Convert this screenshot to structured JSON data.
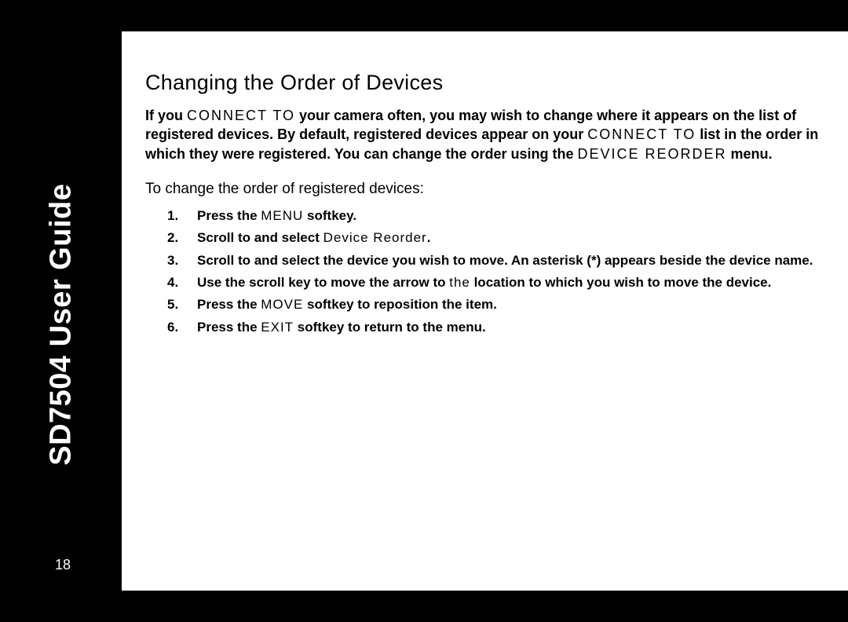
{
  "sidebar": {
    "title": "SD7504 User Guide",
    "page_number": "18"
  },
  "content": {
    "heading": "Changing the Order of Devices",
    "intro_1a": "If you ",
    "intro_1b": "CONNECT TO",
    "intro_1c": " your camera often, you may wish to change where it appears on the list of registered devices. By default, registered devices appear on your ",
    "intro_2a": "CONNECT TO",
    "intro_2b": " list in the order in which they were registered. You can change the order using the ",
    "intro_2c": "DEVICE REORDER",
    "intro_2d": " menu.",
    "lead": "To change the order of registered devices:",
    "steps": [
      {
        "num": "1.",
        "a": "Press the ",
        "b": "MENU",
        "c": " softkey."
      },
      {
        "num": "2.",
        "a": "Scroll to and select ",
        "b": "Device Reorder",
        "c": "."
      },
      {
        "num": "3.",
        "a": "Scroll to and select the device you wish to move. An asterisk (*) appears beside the device name.",
        "b": "",
        "c": ""
      },
      {
        "num": "4.",
        "a": "Use the scroll key to move the arrow to ",
        "b": "the",
        "c": " location to which you wish to move the device."
      },
      {
        "num": "5.",
        "a": "Press the ",
        "b": "MOVE",
        "c": " softkey to reposition the item."
      },
      {
        "num": "6.",
        "a": "Press the ",
        "b": "EXIT",
        "c": " softkey to return to the menu."
      }
    ]
  }
}
